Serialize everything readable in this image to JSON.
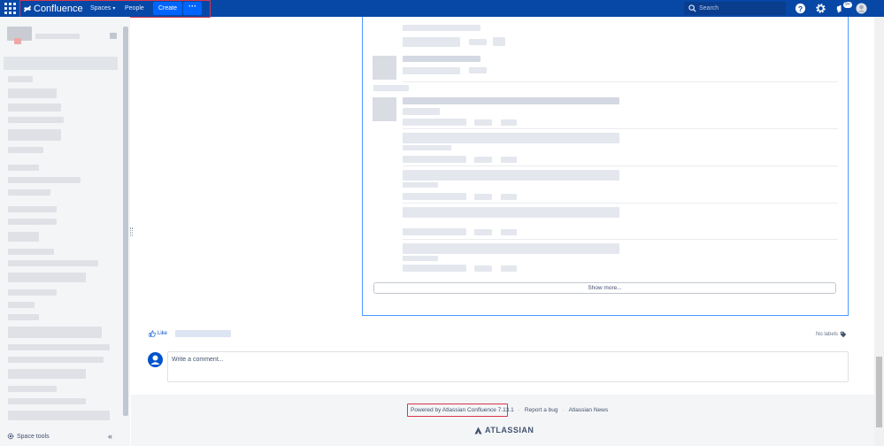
{
  "nav": {
    "brand": "Confluence",
    "spaces_label": "Spaces",
    "people_label": "People",
    "create_label": "Create",
    "more_label": "···",
    "search_placeholder": "Search",
    "notification_badge": "9+",
    "colors": {
      "bar": "#0747a6",
      "create": "#0065ff",
      "highlight": "#d9364b"
    }
  },
  "sidebar": {
    "space_tools_label": "Space tools",
    "collapse_label": "«"
  },
  "content": {
    "show_more_label": "Show more...",
    "like_label": "Like",
    "no_labels_label": "No labels",
    "comment_placeholder": "Write a comment..."
  },
  "footer": {
    "powered_by": "Powered by Atlassian Confluence 7.13.1",
    "report_bug": "Report a bug",
    "atlassian_news": "Atlassian News",
    "separator": "·",
    "brand": "ATLASSIAN"
  }
}
